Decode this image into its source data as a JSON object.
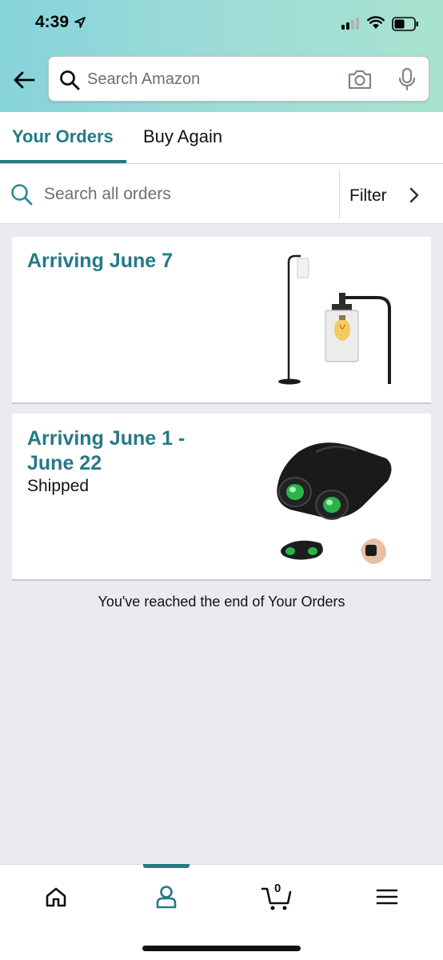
{
  "status_bar": {
    "time": "4:39",
    "icons": [
      "location-arrow-icon",
      "cellular-signal-icon",
      "wifi-icon",
      "battery-icon"
    ]
  },
  "header": {
    "back_icon": "back-arrow-icon",
    "search": {
      "placeholder": "Search Amazon",
      "icons": [
        "search-icon",
        "camera-icon",
        "microphone-icon"
      ]
    }
  },
  "tabs": [
    {
      "label": "Your Orders",
      "active": true
    },
    {
      "label": "Buy Again",
      "active": false
    }
  ],
  "order_search": {
    "placeholder": "Search all orders",
    "filter_label": "Filter"
  },
  "orders": [
    {
      "title": "Arriving June 7",
      "status": "",
      "image": "floor-lamp"
    },
    {
      "title": "Arriving June 1 - June 22",
      "status": "Shipped",
      "image": "binoculars"
    }
  ],
  "end_message": "You've reached the end of Your Orders",
  "bottom_nav": {
    "items": [
      "home-icon",
      "account-icon",
      "cart-icon",
      "menu-icon"
    ],
    "cart_count": "0",
    "active": "account-icon"
  },
  "colors": {
    "accent": "#257a86",
    "header_gradient_start": "#86d3da",
    "header_gradient_end": "#a9e3cf",
    "background": "#eaebee"
  }
}
